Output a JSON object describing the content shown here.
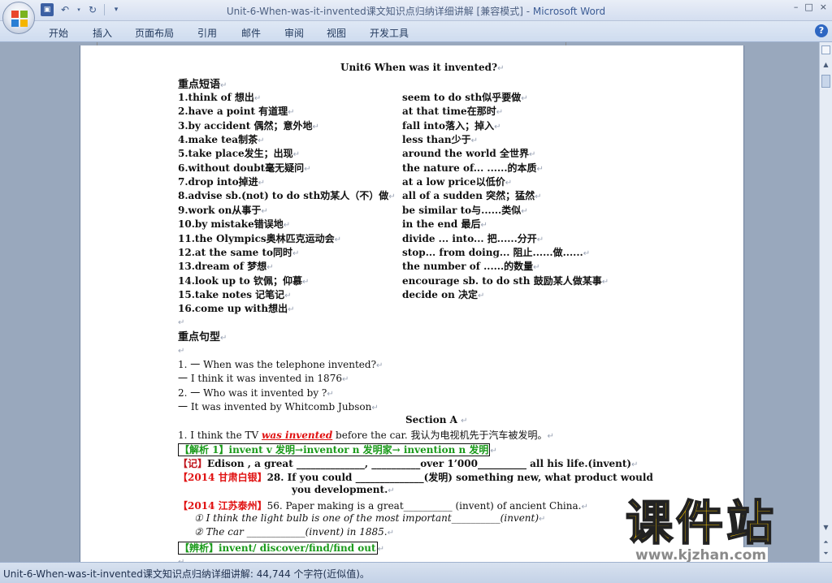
{
  "window": {
    "title": "Unit-6-When-was-it-invented课文知识点归纳详细讲解 [兼容模式] - ",
    "app_name": "Microsoft Word",
    "controls": [
      "–",
      "□",
      "×"
    ]
  },
  "qat": {
    "icons": [
      "save-icon",
      "undo-icon",
      "redo-icon",
      "customize-icon"
    ]
  },
  "ribbon": {
    "tabs": [
      "开始",
      "插入",
      "页面布局",
      "引用",
      "邮件",
      "审阅",
      "视图",
      "开发工具"
    ],
    "help": "?"
  },
  "doc": {
    "title": "Unit6 When was it invented?",
    "heading1": "重点短语",
    "phrases_left": [
      "1.think of 想出",
      "2.have a point 有道理",
      "3.by accident 偶然；意外地",
      "4.make tea制茶",
      "5.take place发生；出现",
      "6.without doubt毫无疑问",
      "7.drop into掉进",
      "8.advise sb.(not) to do sth劝某人（不）做",
      "9.work on从事于",
      "10.by mistake错误地",
      "11.the Olympics奥林匹克运动会",
      "12.at the same to同时",
      "13.dream of 梦想",
      "14.look up to 钦佩；仰慕",
      "15.take notes 记笔记",
      "16.come up with想出"
    ],
    "phrases_right": [
      "seem to do sth似乎要做",
      "at that time在那时",
      "fall into落入；掉入",
      "less than少于",
      "around the world  全世界",
      "the nature of...   ......的本质",
      "at a low price以低价",
      "all of a sudden    突然；猛然",
      "be similar to与......类似",
      "in the end  最后",
      "divide ... into...    把......分开",
      "stop... from doing... 阻止......做......",
      "the number of    ......的数量",
      "encourage sb. to do sth  鼓励某人做某事",
      "decide on  决定"
    ],
    "heading2": "重点句型",
    "sentences": [
      "1. 一   When was the telephone invented?",
      "    一  I think it was invented in 1876",
      "2. 一   Who was it invented by ?",
      "    一  It was invented by Whitcomb Jubson"
    ],
    "section_a": "Section A",
    "ex1_a": "1. I think the TV ",
    "ex1_b": "was invented",
    "ex1_c": " before the car.    我认为电视机先于汽车被发明。",
    "jiexi": "【解析 1】invent    v 发明→inventor    n 发明家→  invention    n 发明",
    "ji_a": "【记】",
    "ji_b": "Edison , a great ______________, __________over 1’000__________ all his life.(invent)",
    "gansu_a": "【2014 甘肃白银】",
    "gansu_b": "28. If you could ______________(发明) something new, what product would",
    "gansu_c": "you development.",
    "jiangsu_a": "【2014 江苏泰州】",
    "jiangsu_b": "56. Paper making is a great__________    (invent) of ancient China.",
    "item1": "① I think the light bulb is one of the most important__________(invent)",
    "item2": "② The car ____________(invent) in 1885.",
    "bianxi": "【辨析】invent/ discover/find/find out",
    "mark": "↵"
  },
  "status": {
    "text": "Unit-6-When-was-it-invented课文知识点归纳详细讲解: 44,744 个字符(近似值)。"
  },
  "watermark": {
    "big": "课件站",
    "url": "www.kjzhan.com"
  }
}
